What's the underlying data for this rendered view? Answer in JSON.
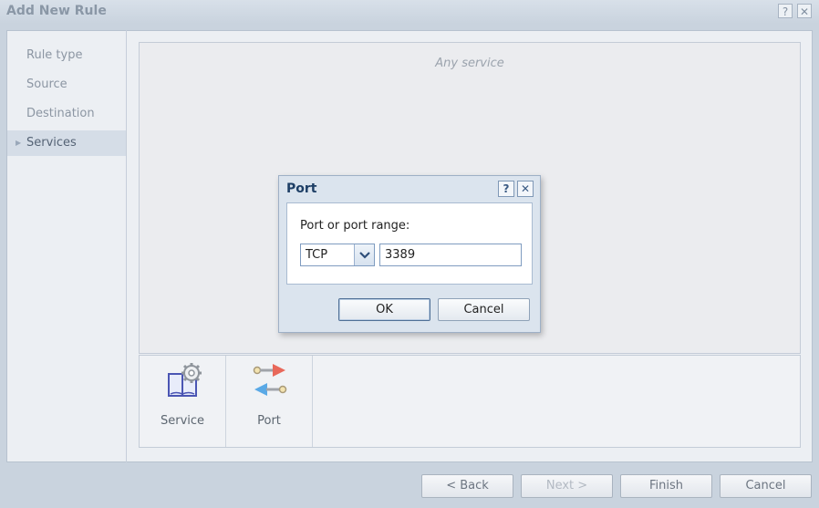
{
  "window": {
    "title": "Add New Rule",
    "help_glyph": "?",
    "close_glyph": "✕"
  },
  "sidebar": {
    "items": [
      {
        "label": "Rule type",
        "active": false
      },
      {
        "label": "Source",
        "active": false
      },
      {
        "label": "Destination",
        "active": false
      },
      {
        "label": "Services",
        "active": true
      }
    ]
  },
  "content": {
    "placeholder": "Any service"
  },
  "choices": [
    {
      "label": "Service",
      "icon": "service-book-gear-icon"
    },
    {
      "label": "Port",
      "icon": "port-arrows-icon"
    }
  ],
  "footer": {
    "back": "< Back",
    "next": "Next >",
    "finish": "Finish",
    "cancel": "Cancel"
  },
  "dialog": {
    "title": "Port",
    "help_glyph": "?",
    "close_glyph": "✕",
    "field_label": "Port or port range:",
    "protocol": "TCP",
    "port_value": "3389",
    "ok": "OK",
    "cancel": "Cancel"
  },
  "colors": {
    "accent": "#1e3f66",
    "port_arrow_out": "#e8685a",
    "port_arrow_in": "#5aa9e6"
  }
}
